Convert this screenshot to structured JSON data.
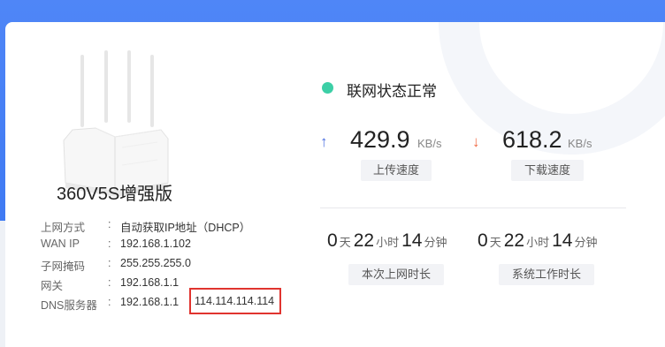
{
  "device": {
    "name": "360V5S增强版"
  },
  "info": [
    {
      "label": "上网方式",
      "colon": ":",
      "value": "自动获取IP地址（DHCP）"
    },
    {
      "label": "WAN IP",
      "colon": ":",
      "value": "192.168.1.102"
    },
    {
      "label": "子网掩码",
      "colon": ":",
      "value": "255.255.255.0"
    },
    {
      "label": "网关",
      "colon": ":",
      "value": "192.168.1.1"
    },
    {
      "label": "DNS服务器",
      "colon": ":",
      "value": "192.168.1.1",
      "value2": "114.114.114.114"
    }
  ],
  "status": {
    "text": "联网状态正常",
    "color": "#3ccfa6"
  },
  "upload": {
    "value": "429.9",
    "unit": "KB/s",
    "label": "上传速度",
    "arrow": "↑",
    "arrow_color": "#4a6ee0"
  },
  "download": {
    "value": "618.2",
    "unit": "KB/s",
    "label": "下载速度",
    "arrow": "↓",
    "arrow_color": "#f06a45"
  },
  "online_time": {
    "days": "0",
    "day_unit": "天",
    "hours": "22",
    "hour_unit": "小时",
    "minutes": "14",
    "minute_unit": "分钟",
    "label": "本次上网时长"
  },
  "work_time": {
    "days": "0",
    "day_unit": "天",
    "hours": "22",
    "hour_unit": "小时",
    "minutes": "14",
    "minute_unit": "分钟",
    "label": "系统工作时长"
  },
  "colors": {
    "accent_blue": "#3f7af3",
    "highlight_red": "#e0342f"
  }
}
